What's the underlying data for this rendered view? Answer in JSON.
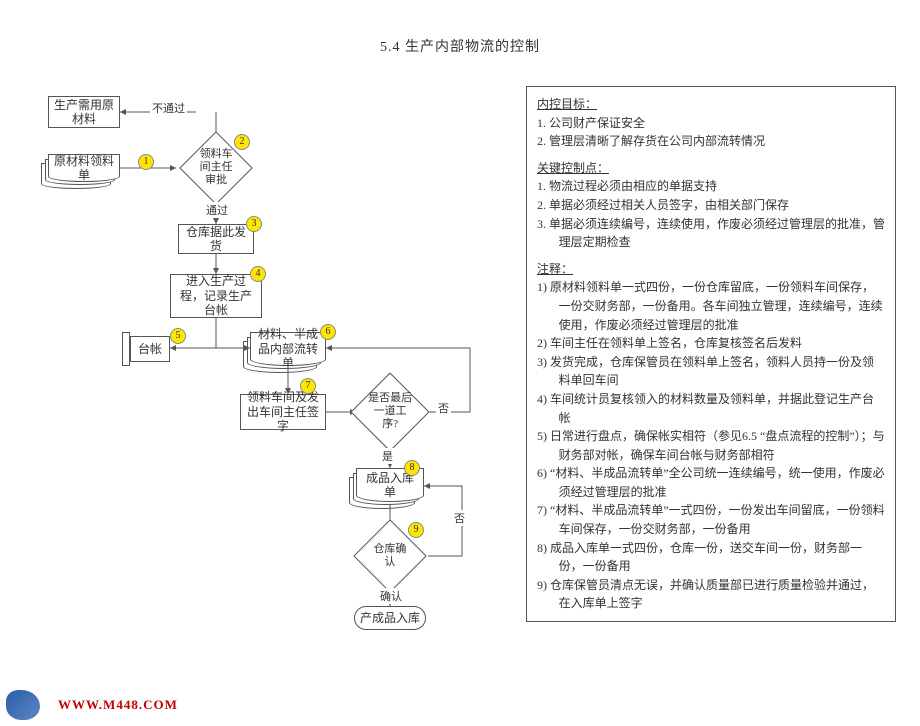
{
  "title": "5.4 生产内部物流的控制",
  "flow": {
    "n1": "生产需用原材料",
    "n2": "原材料领料单",
    "n3": "领料车间主任审批",
    "n4": "仓库据此发货",
    "n5": "进入生产过程，记录生产台帐",
    "n6": "台帐",
    "n7": "材料、半成品内部流转单",
    "n8": "领料车间及发出车间主任签字",
    "n9": "是否最后一道工序?",
    "n10": "成品入库单",
    "n11": "仓库确认",
    "n12": "产成品入库",
    "e_fail": "不通过",
    "e_pass": "通过",
    "e_no": "否",
    "e_yes": "是",
    "e_confirm": "确认"
  },
  "badges": {
    "b1": "1",
    "b2": "2",
    "b3": "3",
    "b4": "4",
    "b5": "5",
    "b6": "6",
    "b7": "7",
    "b8": "8",
    "b9": "9"
  },
  "panel": {
    "h1": "内控目标：",
    "t1": "1. 公司财产保证安全",
    "t2": "2. 管理层清晰了解存货在公司内部流转情况",
    "h2": "关键控制点：",
    "k1": "1. 物流过程必须由相应的单据支持",
    "k2": "2. 单据必须经过相关人员签字，由相关部门保存",
    "k3": "3. 单据必须连续编号，连续使用，作废必须经过管理层的批准，管理层定期检查",
    "h3": "注释：",
    "a1": "1) 原材料领料单一式四份，一份仓库留底，一份领料车间保存，一份交财务部，一份备用。各车间独立管理，连续编号，连续使用，作废必须经过管理层的批准",
    "a2": "2) 车间主任在领料单上签名，仓库复核签名后发料",
    "a3": "3) 发货完成，仓库保管员在领料单上签名，领料人员持一份及领料单回车间",
    "a4": "4) 车间统计员复核领入的材料数量及领料单，并据此登记生产台帐",
    "a5": "5) 日常进行盘点，确保帐实相符（参见6.5 “盘点流程的控制”）；与财务部对帐，确保车间台帐与财务部相符",
    "a6": "6) “材料、半成品流转单”全公司统一连续编号，统一使用，作废必须经过管理层的批准",
    "a7": "7) “材料、半成品流转单”一式四份，一份发出车间留底，一份领料车间保存，一份交财务部，一份备用",
    "a8": "8) 成品入库单一式四份，仓库一份，送交车间一份，财务部一份，一份备用",
    "a9": "9) 仓库保管员清点无误，并确认质量部已进行质量检验并通过，在入库单上签字"
  },
  "footer": {
    "brand": "",
    "url": "WWW.M448.COM"
  }
}
